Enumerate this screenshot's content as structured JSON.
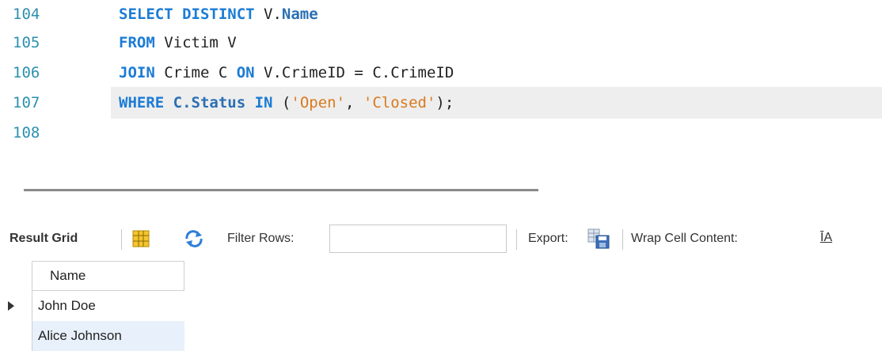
{
  "editor": {
    "lines": [
      {
        "number": "104",
        "tokens": [
          {
            "t": "SELECT DISTINCT ",
            "c": "kw"
          },
          {
            "t": "V.",
            "c": ""
          },
          {
            "t": "Name",
            "c": "fld"
          }
        ]
      },
      {
        "number": "105",
        "tokens": [
          {
            "t": "FROM ",
            "c": "kw"
          },
          {
            "t": "Victim V",
            "c": ""
          }
        ]
      },
      {
        "number": "106",
        "tokens": [
          {
            "t": "JOIN ",
            "c": "kw"
          },
          {
            "t": "Crime C ",
            "c": ""
          },
          {
            "t": "ON ",
            "c": "kw"
          },
          {
            "t": "V.CrimeID = C.CrimeID",
            "c": ""
          }
        ]
      },
      {
        "number": "107",
        "active": true,
        "tokens": [
          {
            "t": "WHERE ",
            "c": "kw"
          },
          {
            "t": "C.Status ",
            "c": "fld"
          },
          {
            "t": "IN ",
            "c": "kw"
          },
          {
            "t": "(",
            "c": ""
          },
          {
            "t": "'Open'",
            "c": "str"
          },
          {
            "t": ", ",
            "c": ""
          },
          {
            "t": "'Closed'",
            "c": "str"
          },
          {
            "t": ");",
            "c": ""
          }
        ]
      },
      {
        "number": "108",
        "tokens": []
      }
    ]
  },
  "toolbar": {
    "result_grid_label": "Result Grid",
    "filter_rows_label": "Filter Rows:",
    "filter_value": "",
    "export_label": "Export:",
    "wrap_label": "Wrap Cell Content:",
    "wrap_icon_text": "ĪA"
  },
  "grid": {
    "column": "Name",
    "rows": [
      "John Doe",
      "Alice Johnson"
    ],
    "selected_index": 1,
    "cursor_index": 0
  }
}
